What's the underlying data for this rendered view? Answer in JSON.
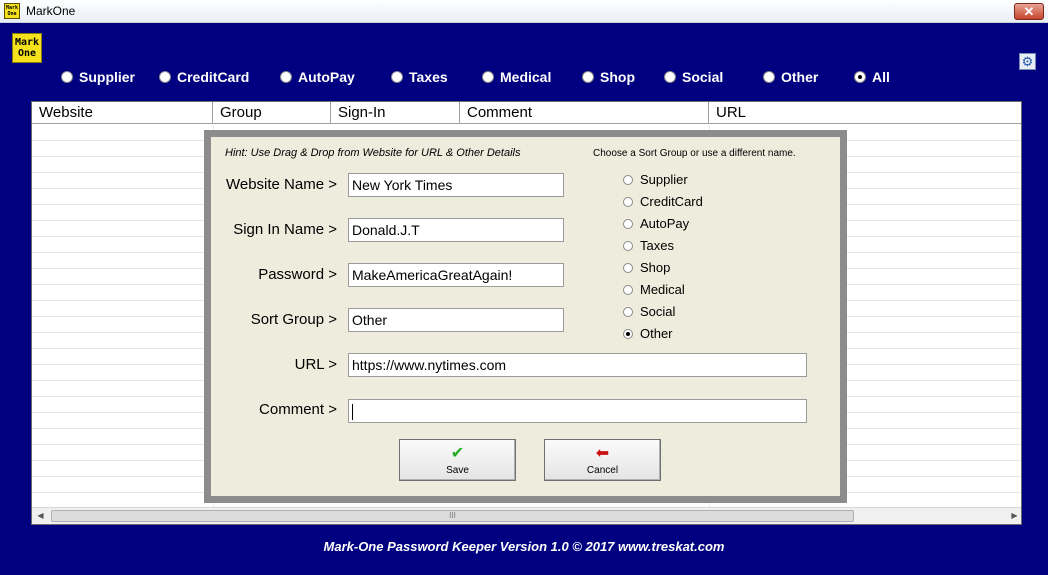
{
  "window": {
    "title": "MarkOne",
    "close_glyph": "✕"
  },
  "logo": {
    "line1": "Mark",
    "line2": "One"
  },
  "filters": [
    {
      "label": "Supplier",
      "selected": false
    },
    {
      "label": "CreditCard",
      "selected": false
    },
    {
      "label": "AutoPay",
      "selected": false
    },
    {
      "label": "Taxes",
      "selected": false
    },
    {
      "label": "Medical",
      "selected": false
    },
    {
      "label": "Shop",
      "selected": false
    },
    {
      "label": "Social",
      "selected": false
    },
    {
      "label": "Other",
      "selected": false
    },
    {
      "label": "All",
      "selected": true
    }
  ],
  "grid": {
    "columns": [
      "Website",
      "Group",
      "Sign-In",
      "Comment",
      "URL"
    ],
    "scroll_grip": "III"
  },
  "dialog": {
    "hint": "Hint: Use Drag & Drop from Website for URL & Other Details",
    "group_prompt": "Choose a Sort Group or use a different  name.",
    "fields": {
      "website_label": "Website Name >",
      "website_value": "New York Times",
      "signin_label": "Sign In Name >",
      "signin_value": "Donald.J.T",
      "password_label": "Password >",
      "password_value": "MakeAmericaGreatAgain!",
      "group_label": "Sort Group >",
      "group_value": "Other",
      "url_label": "URL >",
      "url_value": "https://www.nytimes.com",
      "comment_label": "Comment >",
      "comment_value": ""
    },
    "groups": [
      {
        "label": "Supplier",
        "selected": false
      },
      {
        "label": "CreditCard",
        "selected": false
      },
      {
        "label": "AutoPay",
        "selected": false
      },
      {
        "label": "Taxes",
        "selected": false
      },
      {
        "label": "Shop",
        "selected": false
      },
      {
        "label": "Medical",
        "selected": false
      },
      {
        "label": "Social",
        "selected": false
      },
      {
        "label": "Other",
        "selected": true
      }
    ],
    "save_label": "Save",
    "cancel_label": "Cancel"
  },
  "footer": {
    "text": "Mark-One Password Keeper Version 1.0 © 2017 www.treskat.com"
  },
  "colors": {
    "background": "#000080",
    "dialog": "#eeecdc",
    "save_icon": "#22aa22",
    "cancel_icon": "#cc1111"
  },
  "icons": {
    "save": "checkmark-icon",
    "cancel": "back-arrow-icon",
    "settings": "gear-icon"
  }
}
